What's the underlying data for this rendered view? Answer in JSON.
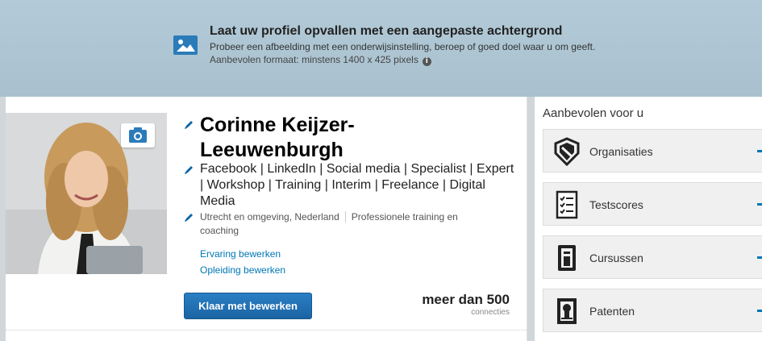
{
  "banner": {
    "title": "Laat uw profiel opvallen met een aangepaste achtergrond",
    "description": "Probeer een afbeelding met een onderwijsinstelling, beroep of goed doel waar u om geeft.",
    "format": "Aanbevolen formaat: minstens 1400 x 425 pixels",
    "icon": "image-icon",
    "info_glyph": "i"
  },
  "profile": {
    "name": "Corinne Keijzer-Leeuwenburgh",
    "headline": "Facebook | LinkedIn | Social media | Specialist | Expert | Workshop | Training | Interim | Freelance | Digital Media",
    "location": "Utrecht en omgeving, Nederland",
    "industry": "Professionele training en coaching",
    "edit_experience": "Ervaring bewerken",
    "edit_education": "Opleiding bewerken",
    "done_button": "Klaar met bewerken",
    "connections_count": "meer dan 500",
    "connections_label": "connecties",
    "icons": [
      "camera-icon",
      "pencil-icon"
    ]
  },
  "recommended": {
    "title": "Aanbevolen voor u",
    "items": [
      {
        "label": "Organisaties",
        "icon": "organization-shield-icon"
      },
      {
        "label": "Testscores",
        "icon": "checklist-icon"
      },
      {
        "label": "Cursussen",
        "icon": "book-icon"
      },
      {
        "label": "Patenten",
        "icon": "patent-document-icon"
      }
    ]
  },
  "colors": {
    "banner_bg": "#afc7d4",
    "link": "#0077b5",
    "button_bg": "#1f6fb4",
    "page_bg": "#d0d6da"
  }
}
